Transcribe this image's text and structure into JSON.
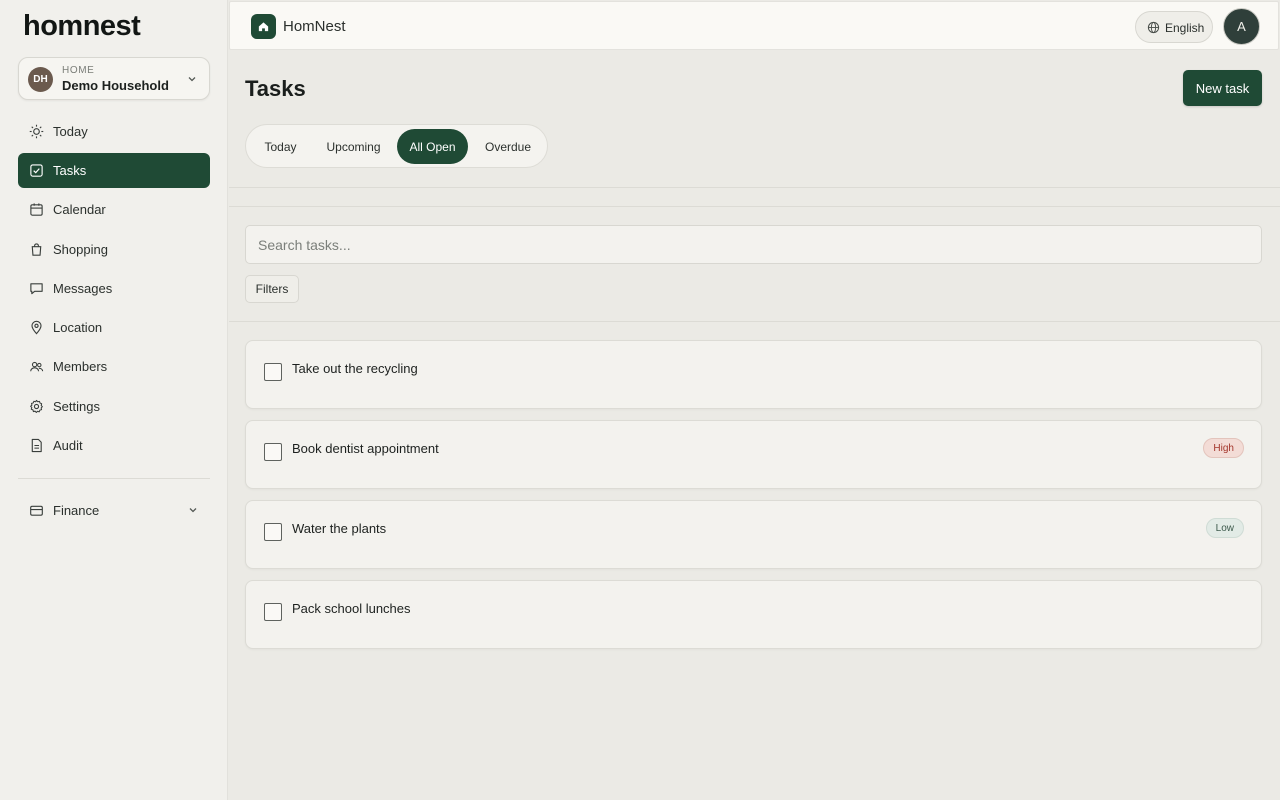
{
  "sidebar": {
    "brand": "homnest",
    "household": {
      "kicker": "HOME",
      "name": "Demo Household",
      "initials": "DH"
    },
    "items": [
      {
        "label": "Today",
        "icon": "sun-icon"
      },
      {
        "label": "Tasks",
        "icon": "checkbox-icon",
        "active": true
      },
      {
        "label": "Calendar",
        "icon": "calendar-icon"
      },
      {
        "label": "Shopping",
        "icon": "shopping-bag-icon"
      },
      {
        "label": "Messages",
        "icon": "message-icon"
      },
      {
        "label": "Location",
        "icon": "map-pin-icon"
      },
      {
        "label": "Members",
        "icon": "users-icon"
      },
      {
        "label": "Settings",
        "icon": "gear-icon"
      },
      {
        "label": "Audit",
        "icon": "document-icon"
      }
    ],
    "finance": {
      "label": "Finance",
      "icon": "wallet-icon"
    }
  },
  "topbar": {
    "app_name": "HomNest",
    "language": "English",
    "user_initial": "A"
  },
  "main": {
    "title": "Tasks",
    "new_task_label": "New task",
    "tabs": [
      {
        "label": "Today"
      },
      {
        "label": "Upcoming"
      },
      {
        "label": "All Open",
        "active": true
      },
      {
        "label": "Overdue"
      }
    ],
    "search_placeholder": "Search tasks...",
    "filters_label": "Filters",
    "tasks": [
      {
        "title": "Take out the recycling",
        "priority": ""
      },
      {
        "title": "Book dentist appointment",
        "priority": "High"
      },
      {
        "title": "Water the plants",
        "priority": "Low"
      },
      {
        "title": "Pack school lunches",
        "priority": ""
      }
    ]
  },
  "colors": {
    "accent": "#1f4a35",
    "background": "#ebeae5",
    "sidebar": "#f1f0ec",
    "high_badge": "#f3dcd6",
    "low_badge": "#e2ebe6"
  }
}
